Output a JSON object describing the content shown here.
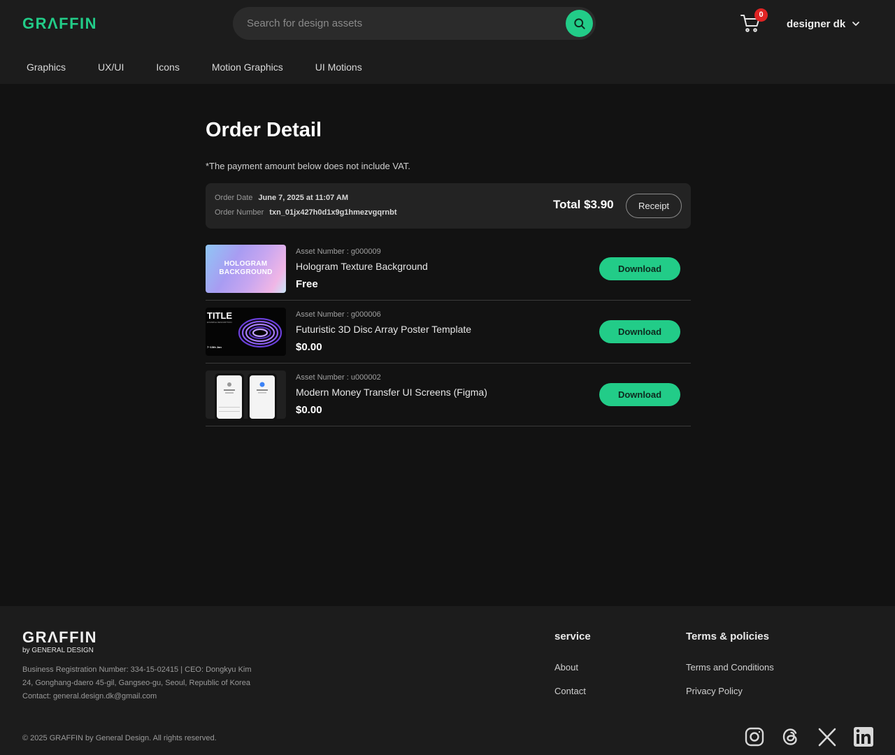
{
  "header": {
    "logo": "GRΛFFIN",
    "search": {
      "placeholder": "Search for design assets"
    },
    "cart_count": "0",
    "user_name": "designer dk"
  },
  "nav": {
    "items": [
      {
        "label": "Graphics"
      },
      {
        "label": "UX/UI"
      },
      {
        "label": "Icons"
      },
      {
        "label": "Motion Graphics"
      },
      {
        "label": "UI Motions"
      }
    ]
  },
  "main": {
    "title": "Order Detail",
    "vat_note": "*The payment amount below does not include VAT.",
    "order": {
      "date_label": "Order Date",
      "date_value": "June 7, 2025 at 11:07 AM",
      "number_label": "Order Number",
      "number_value": "txn_01jx427h0d1x9g1hmezvgqrnbt",
      "total": "Total $3.90",
      "receipt_label": "Receipt"
    },
    "items": [
      {
        "asset_number": "Asset Number : g000009",
        "title": "Hologram Texture Background",
        "price": "Free",
        "download_label": "Download",
        "thumb_text_1": "HOLOGRAM",
        "thumb_text_2": "BACKGROUND"
      },
      {
        "asset_number": "Asset Number : g000006",
        "title": "Futuristic 3D Disc Array Poster Template",
        "price": "$0.00",
        "download_label": "Download",
        "thumb_text_1": "TITLE",
        "thumb_text_2": "EXAMPLE DESCRIPTION",
        "thumb_text_3": "7~10th Jan"
      },
      {
        "asset_number": "Asset Number : u000002",
        "title": "Modern Money Transfer UI Screens (Figma)",
        "price": "$0.00",
        "download_label": "Download"
      }
    ]
  },
  "footer": {
    "logo": "GRΛFFIN",
    "sub": "by GENERAL DESIGN",
    "info_1": "Business Registration Number: 334-15-02415 | CEO: Dongkyu Kim",
    "info_2": "24, Gonghang-daero 45-gil, Gangseo-gu, Seoul, Republic of Korea",
    "info_3": "Contact: general.design.dk@gmail.com",
    "service_heading": "service",
    "service_links": [
      "About",
      "Contact"
    ],
    "policies_heading": "Terms & policies",
    "policies_links": [
      "Terms and Conditions",
      "Privacy Policy"
    ],
    "copyright": "© 2025 GRAFFIN by General Design. All rights reserved.",
    "social_icons": [
      "instagram-icon",
      "threads-icon",
      "x-icon",
      "linkedin-icon"
    ]
  },
  "colors": {
    "accent": "#22cc88",
    "badge": "#e02424",
    "background": "#121212",
    "surface": "#1c1c1c"
  }
}
